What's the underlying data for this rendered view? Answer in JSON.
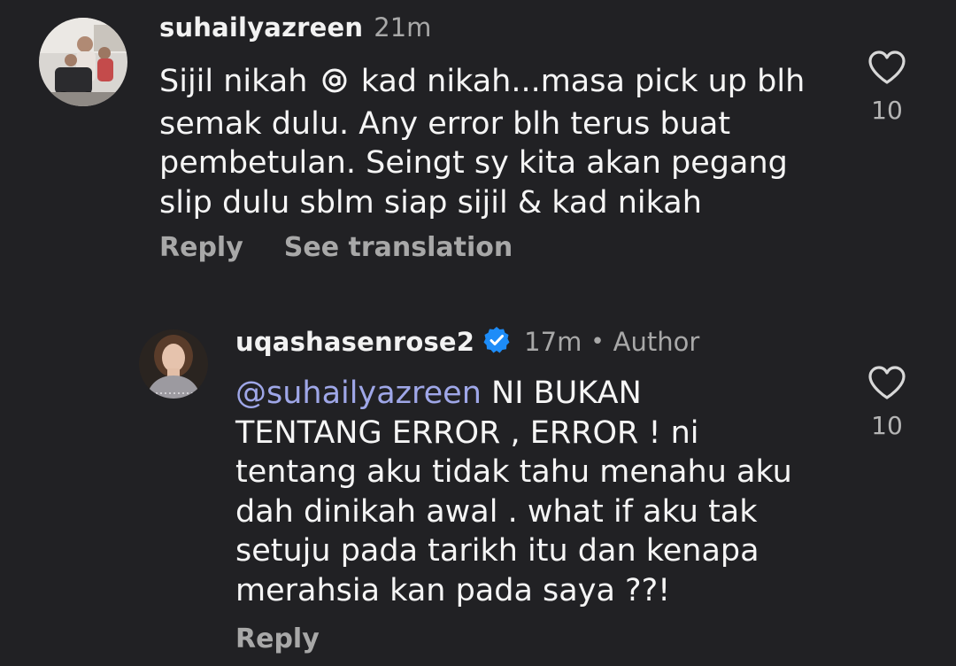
{
  "comments": [
    {
      "username": "suhailyazreen",
      "time": "21m",
      "lines": [
        {
          "before": "Sijil nikah ",
          "after": " kad nikah...masa pick up blh"
        },
        {
          "before": "semak dulu. Any error blh terus buat",
          "after": ""
        },
        {
          "before": "pembetulan. Seingt sy kita akan pegang",
          "after": ""
        },
        {
          "before": "slip dulu sblm siap sijil & kad nikah",
          "after": ""
        }
      ],
      "like_count": "10",
      "reply_label": "Reply",
      "translate_label": "See translation"
    },
    {
      "username": "uqashasenrose2",
      "time": "17m",
      "author_badge": "Author",
      "separator": "•",
      "mention": "@suhailyazreen",
      "lines": [
        " NI BUKAN",
        "TENTANG ERROR , ERROR ! ni",
        "tentang aku tidak tahu menahu aku",
        "dah dinikah awal . what if aku tak",
        "setuju pada tarikh itu dan kenapa",
        "merahsia kan pada saya ??!"
      ],
      "like_count": "10",
      "reply_label": "Reply"
    }
  ],
  "colors": {
    "background": "#212124",
    "text": "#f5f5f5",
    "muted": "#a8a8a8",
    "mention": "#9fa7e8",
    "verified": "#1d8cf8"
  },
  "icons": {
    "like": "heart-outline-icon",
    "verified": "verified-badge-icon",
    "threads": "threads-logo-icon"
  }
}
